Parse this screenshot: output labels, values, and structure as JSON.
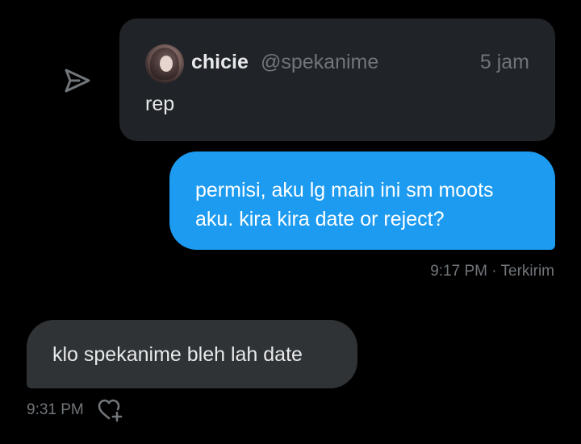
{
  "quoted_post": {
    "name": "chicie",
    "handle": "@spekanime",
    "time": "5 jam",
    "text": "rep"
  },
  "messages": [
    {
      "direction": "sent",
      "text_line1": "permisi, aku lg main ini sm moots",
      "text_line2": "aku. kira kira date or reject?",
      "meta": "9:17 PM · Terkirim"
    },
    {
      "direction": "received",
      "text": "klo spekanime bleh lah date",
      "meta": "9:31 PM"
    }
  ],
  "icons": {
    "share": "share-icon",
    "react": "add-reaction-icon"
  },
  "colors": {
    "background": "#000000",
    "sent_bubble": "#1d9bf0",
    "received_bubble": "#2f3336",
    "card": "#202327",
    "muted_text": "#71767b"
  }
}
